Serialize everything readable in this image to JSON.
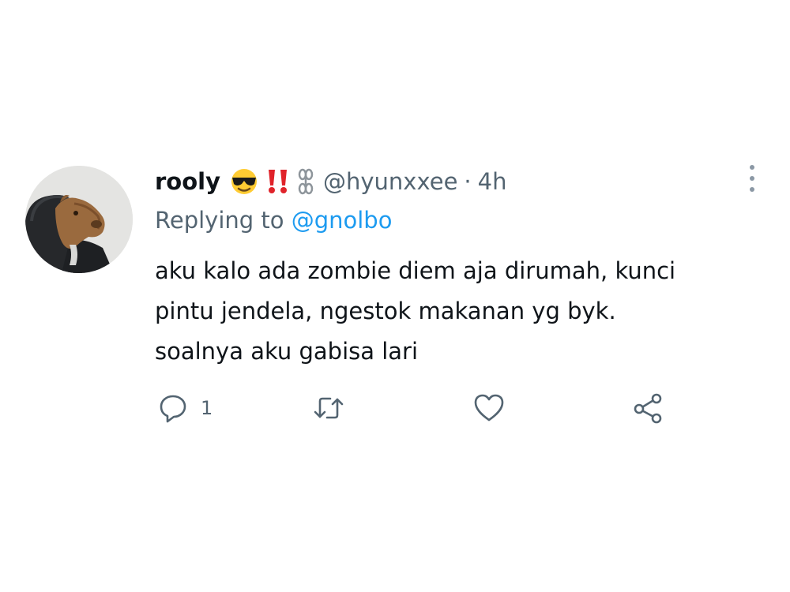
{
  "tweet": {
    "display_name": "rooly",
    "name_emojis": [
      "smiling-face-with-sunglasses",
      "double-exclamation-mark",
      "chain-link"
    ],
    "handle": "@hyunxxee",
    "separator": "·",
    "time": "4h",
    "replying_prefix": "Replying to",
    "replying_handle": "@gnolbo",
    "body_lines": [
      "aku kalo ada zombie diem aja dirumah, kunci",
      "pintu jendela, ngestok makanan yg byk.",
      "soalnya aku gabisa lari"
    ]
  },
  "actions": {
    "reply_icon": "comment-bubble-icon",
    "reply_count": "1",
    "retweet_icon": "retweet-icon",
    "like_icon": "heart-icon",
    "share_icon": "share-nodes-icon"
  },
  "colors": {
    "text_primary": "#0f1419",
    "text_secondary": "#536471",
    "link_blue": "#1d9bf0"
  }
}
